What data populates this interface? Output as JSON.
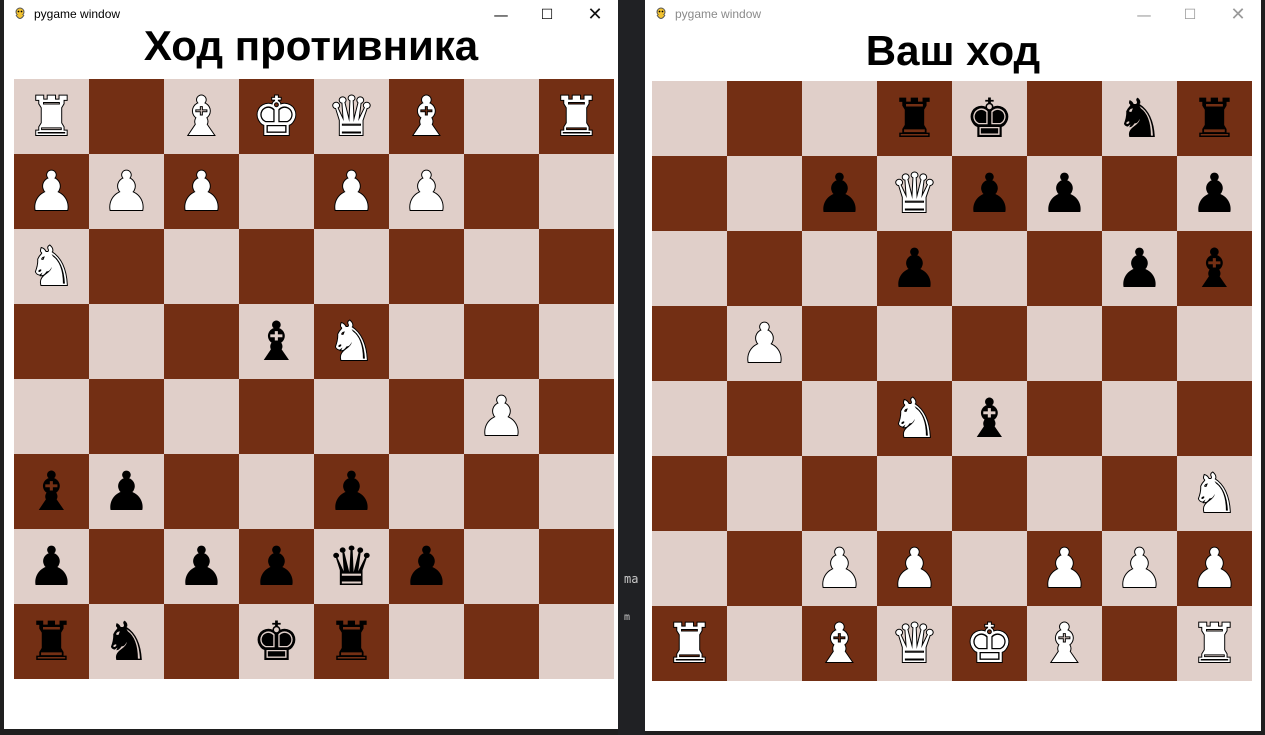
{
  "left_window": {
    "title": "pygame window",
    "heading": "Ход противника",
    "board": [
      [
        "wR",
        "",
        "wB",
        "wK",
        "wQ",
        "wB",
        "",
        "wR"
      ],
      [
        "wP",
        "wP",
        "wP",
        "",
        "wP",
        "wP",
        "",
        ""
      ],
      [
        "wN",
        "",
        "",
        "",
        "",
        "",
        "",
        ""
      ],
      [
        "",
        "",
        "",
        "bB",
        "wN",
        "",
        "",
        ""
      ],
      [
        "",
        "",
        "",
        "",
        "",
        "",
        "wP",
        ""
      ],
      [
        "bB",
        "bP",
        "",
        "",
        "bP",
        "",
        "",
        ""
      ],
      [
        "bP",
        "",
        "bP",
        "bP",
        "bQ",
        "bP",
        "",
        ""
      ],
      [
        "bR",
        "bN",
        "",
        "bK",
        "bR",
        "",
        "",
        ""
      ]
    ],
    "controls": {
      "minimize": "—",
      "maximize": "☐",
      "close": "✕"
    }
  },
  "right_window": {
    "title": "pygame window",
    "heading": "Ваш ход",
    "board": [
      [
        "",
        "",
        "",
        "bR",
        "bK",
        "",
        "bN",
        "bR"
      ],
      [
        "",
        "",
        "bP",
        "wQ",
        "bP",
        "bP",
        "",
        "bP"
      ],
      [
        "",
        "",
        "",
        "bP",
        "",
        "",
        "bP",
        "bB"
      ],
      [
        "",
        "wP",
        "",
        "",
        "",
        "",
        "",
        ""
      ],
      [
        "",
        "",
        "",
        "wN",
        "bB",
        "",
        "",
        ""
      ],
      [
        "",
        "",
        "",
        "",
        "",
        "",
        "",
        "wN"
      ],
      [
        "",
        "",
        "wP",
        "wP",
        "",
        "wP",
        "wP",
        "wP"
      ],
      [
        "wR",
        "",
        "wB",
        "wQ",
        "wK",
        "wB",
        "",
        "wR"
      ]
    ],
    "controls": {
      "minimize": "—",
      "maximize": "☐",
      "close": "✕"
    }
  },
  "colors": {
    "light_square": "#e0cfc9",
    "dark_square": "#732f14"
  },
  "background_text": {
    "line1": "ma",
    "line2": "m"
  },
  "icons": {
    "title": "pygame-snake-icon"
  }
}
